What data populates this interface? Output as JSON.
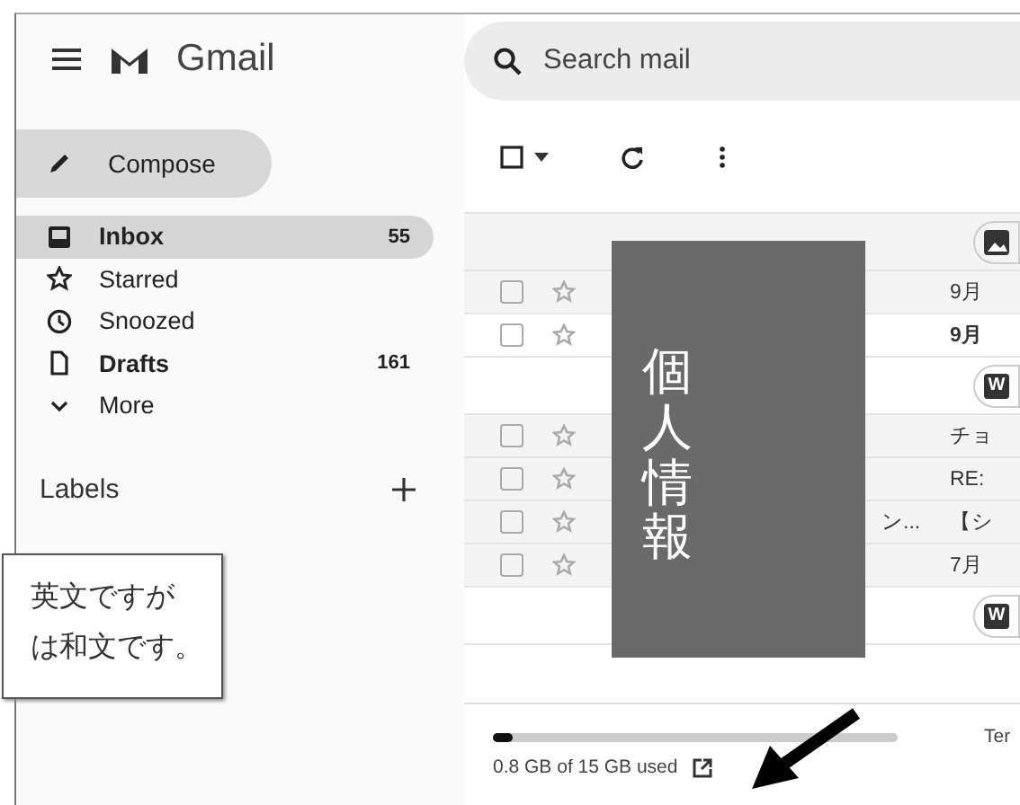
{
  "header": {
    "app_name": "Gmail",
    "search": {
      "placeholder": "Search mail"
    }
  },
  "compose": {
    "label": "Compose"
  },
  "nav": [
    {
      "kind": "inbox",
      "label": "Inbox",
      "count": "55",
      "selected": true,
      "unread": true
    },
    {
      "kind": "star",
      "label": "Starred",
      "selected": false,
      "unread": false
    },
    {
      "kind": "clock",
      "label": "Snoozed",
      "selected": false,
      "unread": false
    },
    {
      "kind": "file",
      "label": "Drafts",
      "count": "161",
      "selected": false,
      "unread": true
    },
    {
      "kind": "chevron",
      "label": "More",
      "selected": false,
      "unread": false
    }
  ],
  "labels_heading": "Labels",
  "callout": {
    "lines": [
      "英文ですが",
      "は和文です。"
    ]
  },
  "rows": [
    {
      "kind": "image_attachment"
    },
    {
      "kind": "email",
      "subject": "9月",
      "unread": false,
      "checked": false,
      "starred": false
    },
    {
      "kind": "email",
      "subject": "9月",
      "unread": true,
      "checked": false,
      "starred": false
    },
    {
      "kind": "doc_attachment",
      "label": "W"
    },
    {
      "kind": "email",
      "subject": "チョ",
      "unread": false,
      "checked": false,
      "starred": false
    },
    {
      "kind": "email",
      "subject": "RE:",
      "unread": false,
      "checked": false,
      "starred": false
    },
    {
      "kind": "email",
      "sender": "ン...",
      "subject": "【シ",
      "unread": false,
      "checked": false,
      "starred": false
    },
    {
      "kind": "email",
      "subject": "7月",
      "unread": false,
      "checked": false,
      "starred": false
    },
    {
      "kind": "doc_attachment",
      "label": "W"
    }
  ],
  "redaction": {
    "label": "個人情報"
  },
  "storage": {
    "level": 0.05,
    "text": "0.8 GB of 15 GB used"
  },
  "footer_link": "Ter"
}
